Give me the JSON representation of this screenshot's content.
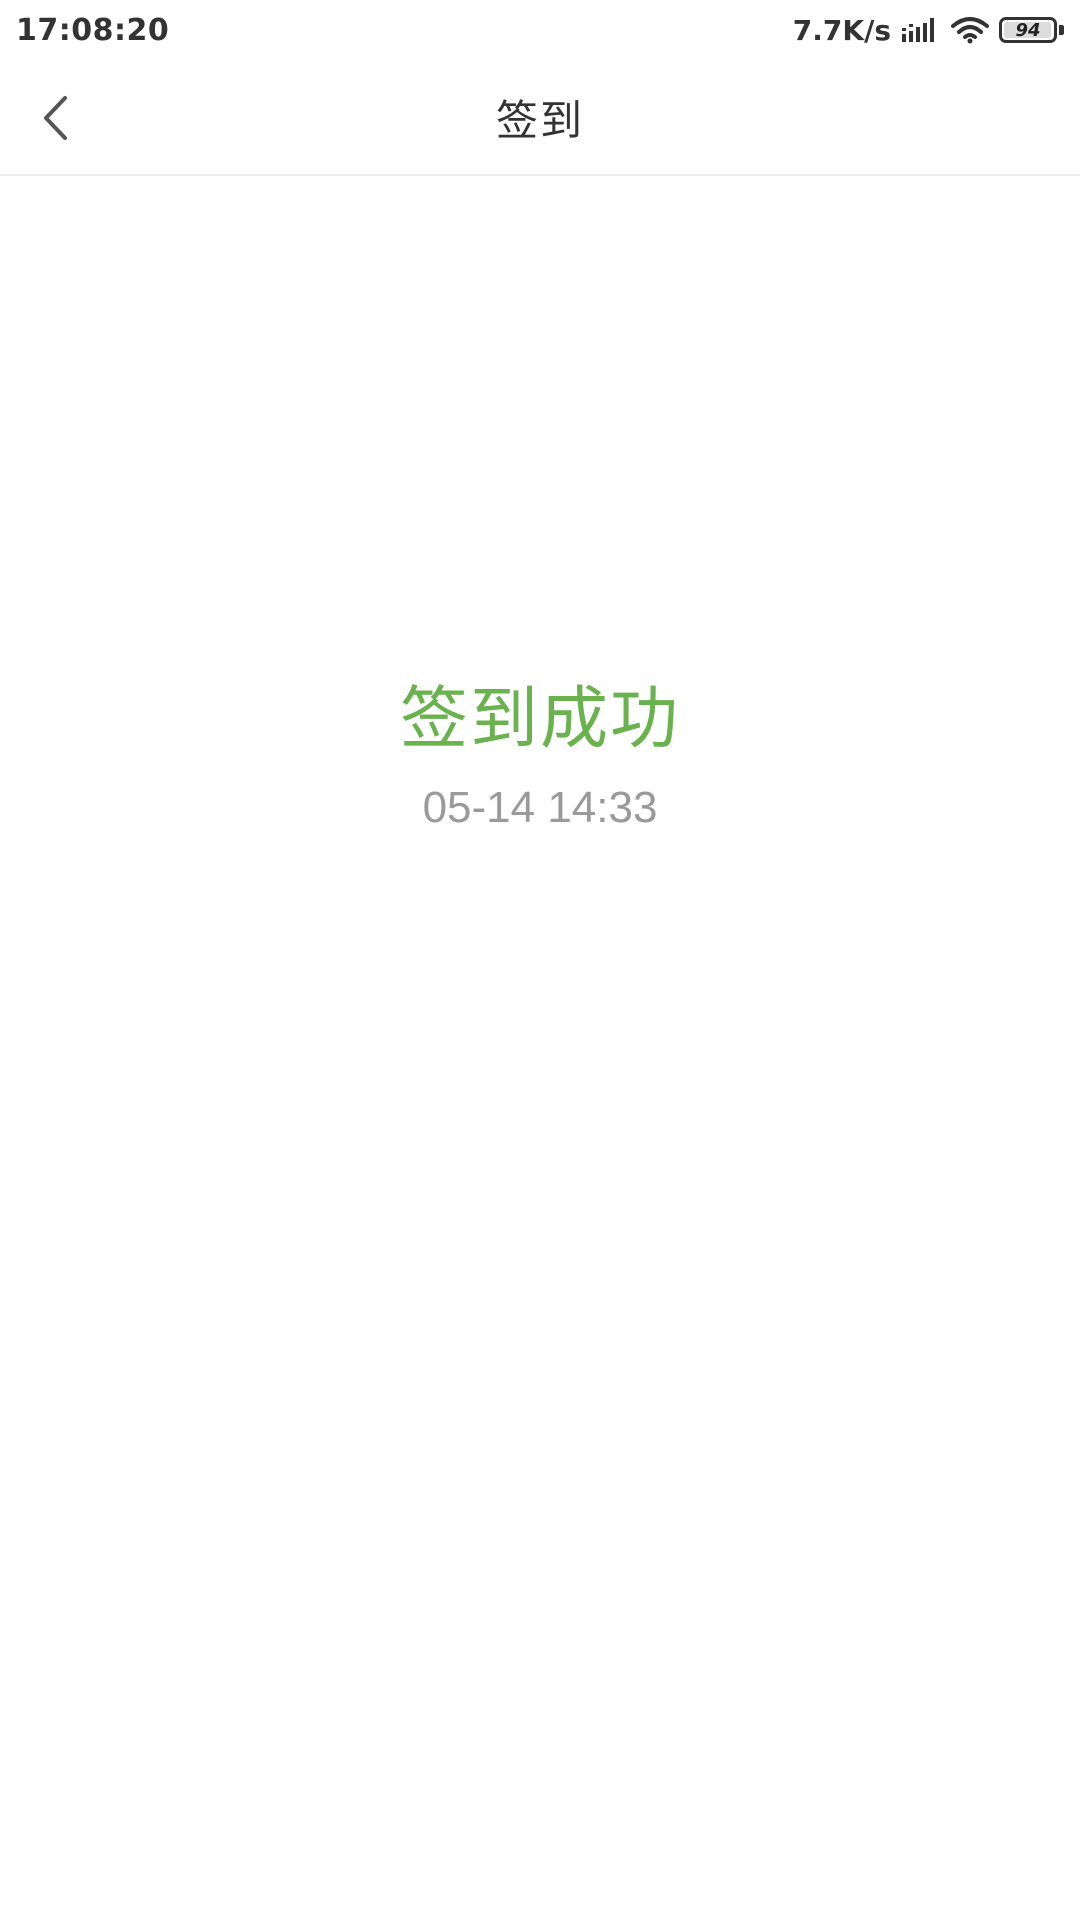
{
  "status_bar": {
    "time": "17:08:20",
    "net_speed": "7.7K/s",
    "signal_icon": "signal-icon",
    "wifi_icon": "wifi-icon",
    "battery_level": "94"
  },
  "nav": {
    "back_icon": "chevron-left-icon",
    "title": "签到"
  },
  "result": {
    "title": "签到成功",
    "time": "05-14 14:33"
  },
  "colors": {
    "success_green": "#6ab24e",
    "muted_gray": "#9a9a9a",
    "text_dark": "#333333"
  }
}
